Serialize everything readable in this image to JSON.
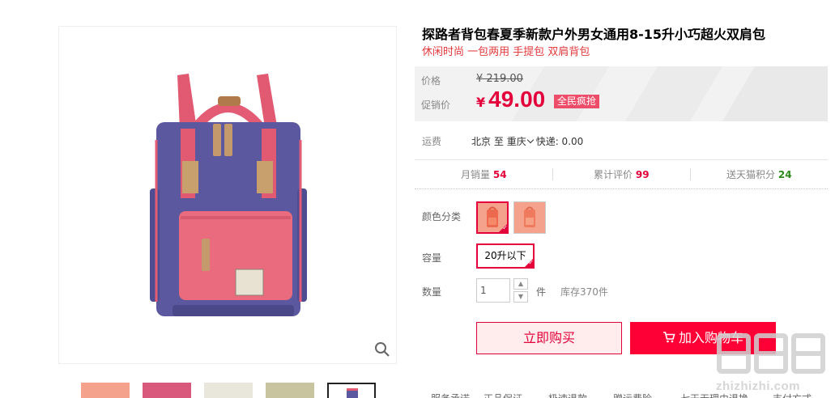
{
  "product": {
    "title": "探路者背包春夏季新款户外男女通用8-15升小巧超火双肩包",
    "subtitle": "休闲时尚 一包两用 手提包 双肩背包"
  },
  "price": {
    "original_label": "价格",
    "original_value": "¥ 219.00",
    "promo_label": "促销价",
    "currency": "¥",
    "promo_value": "49.00",
    "badge": "全民疯抢"
  },
  "shipping": {
    "label": "运费",
    "from": "北京",
    "to_word": "至",
    "destination": "重庆",
    "express": "快递: 0.00"
  },
  "stats": {
    "sales_label": "月销量",
    "sales_value": "54",
    "reviews_label": "累计评价",
    "reviews_value": "99",
    "points_label": "送天猫积分",
    "points_value": "24"
  },
  "options": {
    "color_label": "颜色分类",
    "capacity_label": "容量",
    "capacity_value": "20升以下",
    "quantity_label": "数量",
    "quantity_value": "1",
    "quantity_unit": "件",
    "stock": "库存370件"
  },
  "buttons": {
    "buy_now": "立即购买",
    "add_to_cart": "加入购物车"
  },
  "services": [
    "服务承诺",
    "正品保证",
    "极速退款",
    "赠运费险",
    "七天无理由退换",
    "支付方式"
  ],
  "watermark": {
    "glyphs": "值值值",
    "url": "zhizhizhi.com"
  },
  "colors": {
    "accent": "#e4003a",
    "cart_button": "#ff0036",
    "bag_body": "#5b58a0",
    "bag_pink": "#ea6a7e",
    "bag_strap": "#e15a72"
  },
  "icons": {
    "zoom": "magnifier-icon",
    "cart": "shopping-cart-icon",
    "select_arrow": "chevron-down-icon"
  }
}
